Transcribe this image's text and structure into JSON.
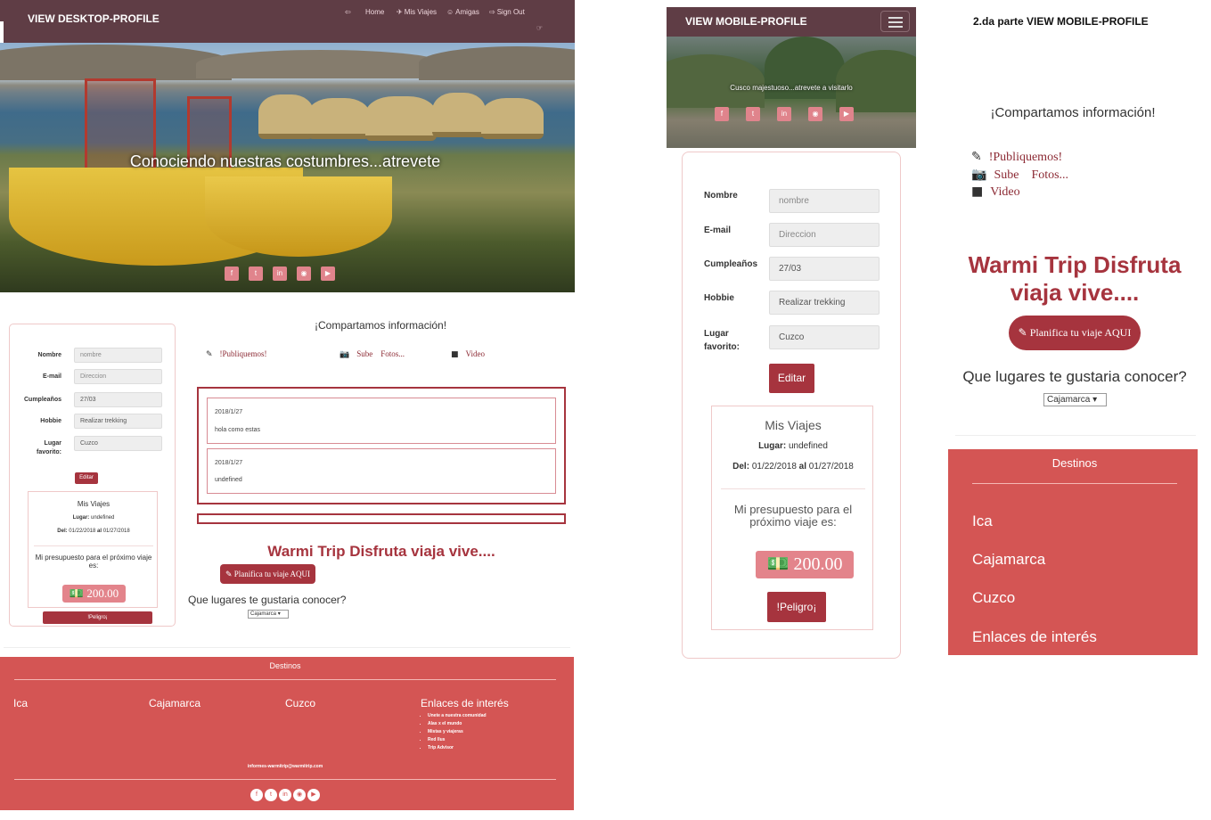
{
  "desktop": {
    "brand": "VIEW DESKTOP-PROFILE",
    "nav": [
      {
        "icon": "login-icon",
        "glyph": "⇦",
        "label": ""
      },
      {
        "icon": "",
        "glyph": "",
        "label": "Home"
      },
      {
        "icon": "plane-icon",
        "glyph": "✈",
        "label": "Mis Viajes"
      },
      {
        "icon": "friends-icon",
        "glyph": "☺",
        "label": "Amigas"
      },
      {
        "icon": "signout-icon",
        "glyph": "⇨",
        "label": "Sign Out"
      }
    ],
    "hero_caption": "Conociendo nuestras costumbres...atrevete",
    "social": [
      "f",
      "t",
      "in",
      "◉",
      "▶"
    ],
    "profile": {
      "fields": [
        {
          "label": "Nombre",
          "placeholder": "nombre",
          "value": ""
        },
        {
          "label": "E-mail",
          "placeholder": "Direccion",
          "value": ""
        },
        {
          "label": "Cumpleaños",
          "placeholder": "",
          "value": "27/03"
        },
        {
          "label": "Hobbie",
          "placeholder": "",
          "value": "Realizar trekking"
        },
        {
          "label": "Lugar favorito:",
          "placeholder": "",
          "value": "Cuzco"
        }
      ],
      "edit_label": "Editar",
      "trips_title": "Mis Viajes",
      "place_label": "Lugar:",
      "place_value": "undefined",
      "dates_from_label": "Del:",
      "dates_from": "01/22/2018",
      "dates_to_label": "al",
      "dates_to": "01/27/2018",
      "budget_text": "Mi presupuesto para el próximo viaje es:",
      "amount": "200.00",
      "danger_label": "!Peligro¡"
    },
    "share": {
      "title": "¡Compartamos información!",
      "publish": "!Publiquemos!",
      "photos": "Sube    Fotos...",
      "video": "Video"
    },
    "posts": [
      {
        "date": "2018/1/27",
        "text": "hola como estas"
      },
      {
        "date": "2018/1/27",
        "text": "undefined"
      }
    ],
    "slogan": "Warmi Trip Disfruta viaja vive....",
    "plan_button": "Planifica tu viaje AQUI",
    "question": "Que lugares te gustaria conocer?",
    "select_value": "Cajamarca",
    "footer": {
      "title": "Destinos",
      "columns": [
        "Ica",
        "Cajamarca",
        "Cuzco",
        "Enlaces de interés"
      ],
      "links": [
        "Unete a nuestra comunidad",
        "Alas x el mundo",
        "Mistas y viajeras",
        "Red Ilus",
        "Trip Advisor"
      ],
      "email": "informes-warmitrip@warmitrip.com",
      "social": [
        "f",
        "t",
        "in",
        "◉",
        "▶"
      ]
    }
  },
  "mobile": {
    "brand": "VIEW MOBILE-PROFILE",
    "hero_caption": "Cusco majestuoso...atrevete a visitarlo",
    "social": [
      "f",
      "t",
      "in",
      "◉",
      "▶"
    ],
    "fields": [
      {
        "label": "Nombre",
        "placeholder": "nombre",
        "value": ""
      },
      {
        "label": "E-mail",
        "placeholder": "Direccion",
        "value": ""
      },
      {
        "label": "Cumpleaños",
        "placeholder": "",
        "value": "27/03"
      },
      {
        "label": "Hobbie",
        "placeholder": "",
        "value": "Realizar trekking"
      },
      {
        "label": "Lugar favorito:",
        "placeholder": "",
        "value": "Cuzco"
      }
    ],
    "edit_label": "Editar",
    "trips_title": "Mis Viajes",
    "place_label": "Lugar:",
    "place_value": "undefined",
    "dates_from_label": "Del:",
    "dates_from": "01/22/2018",
    "dates_to_label": "al",
    "dates_to": "01/27/2018",
    "budget_text": "Mi presupuesto para el próximo viaje es:",
    "amount": "200.00",
    "danger_label": "!Peligro¡"
  },
  "mobile_part2": {
    "title": "2.da parte VIEW MOBILE-PROFILE",
    "share_title": "¡Compartamos información!",
    "publish": "!Publiquemos!",
    "photos": "Sube    Fotos...",
    "video": "Video",
    "slogan": "Warmi Trip Disfruta viaja vive....",
    "plan_button": "Planifica tu viaje AQUI",
    "question": "Que lugares te gustaria conocer?",
    "select_value": "Cajamarca",
    "footer_title": "Destinos",
    "footer_items": [
      "Ica",
      "Cajamarca",
      "Cuzco",
      "Enlaces de interés"
    ]
  },
  "colors": {
    "nav": "#5f3d45",
    "accent": "#a6343e",
    "footer": "#d45554",
    "money": "#e3848b"
  }
}
